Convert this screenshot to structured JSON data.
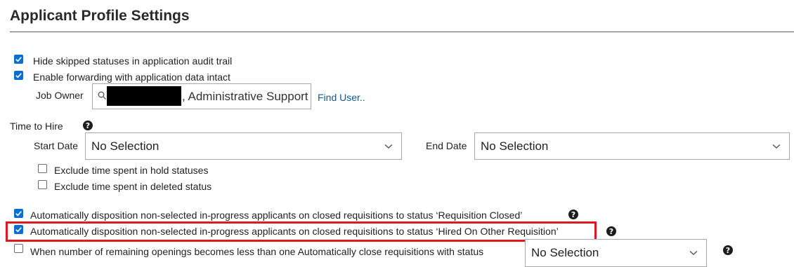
{
  "page": {
    "title": "Applicant Profile Settings"
  },
  "audit": {
    "hide_skipped_label": "Hide skipped statuses in application audit trail",
    "hide_skipped_checked": true,
    "enable_forwarding_label": "Enable forwarding with application data intact",
    "enable_forwarding_checked": true
  },
  "job_owner": {
    "label": "Job Owner",
    "value_visible": ", Administrative Support",
    "find_user_link": "Find User.."
  },
  "time_to_hire": {
    "label": "Time to Hire",
    "start_date_label": "Start Date",
    "start_date_value": "No Selection",
    "end_date_label": "End Date",
    "end_date_value": "No Selection",
    "exclude_hold_label": "Exclude time spent in hold statuses",
    "exclude_hold_checked": false,
    "exclude_deleted_label": "Exclude time spent in deleted status",
    "exclude_deleted_checked": false
  },
  "disposition": {
    "requisition_closed_label": "Automatically disposition non-selected in-progress applicants on closed requisitions to status ‘Requisition Closed’",
    "requisition_closed_checked": true,
    "hired_other_label": "Automatically disposition non-selected in-progress applicants on closed requisitions to status ‘Hired On Other Requisition’",
    "hired_other_checked": true,
    "remaining_openings_label": "When number of remaining openings becomes less than one Automatically close requisitions with status",
    "remaining_openings_checked": false,
    "remaining_openings_value": "No Selection"
  },
  "colors": {
    "checkbox_accent": "#0a6ed1",
    "highlight_border": "#e0191f",
    "link": "#0a5a9e"
  },
  "icons": [
    "checkbox-checked",
    "checkbox-unchecked",
    "help-icon",
    "search-icon",
    "chevron-down-icon"
  ]
}
